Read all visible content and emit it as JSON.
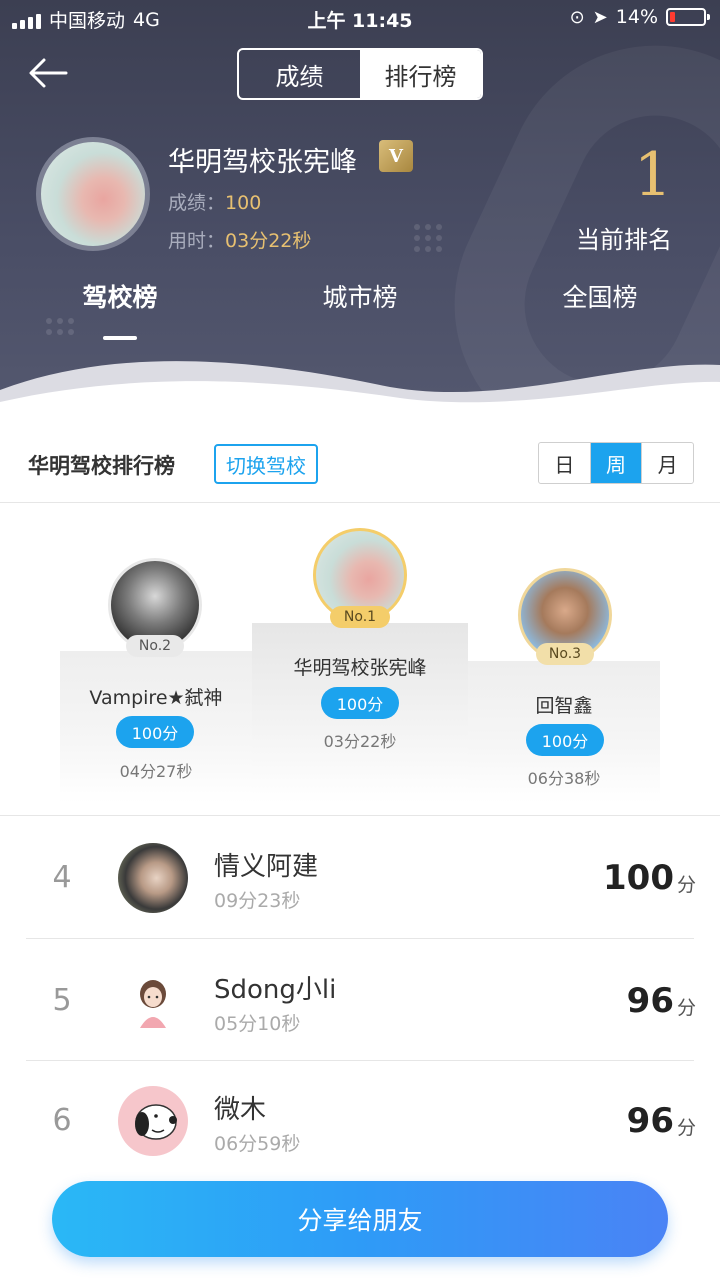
{
  "status_bar": {
    "carrier": "中国移动",
    "network": "4G",
    "time": "上午 11:45",
    "battery": "14%"
  },
  "nav": {
    "segments": [
      "成绩",
      "排行榜"
    ],
    "active_segment": "排行榜"
  },
  "me": {
    "name": "华明驾校张宪峰",
    "vip_badge": "V",
    "score_label": "成绩：",
    "score": "100",
    "time_label": "用时：",
    "time": "03分22秒",
    "rank": "1",
    "rank_label": "当前排名"
  },
  "rank_tabs": [
    "驾校榜",
    "城市榜",
    "全国榜"
  ],
  "active_rank_tab": "驾校榜",
  "board": {
    "title": "华明驾校排行榜",
    "switch_label": "切换驾校",
    "periods": [
      "日",
      "周",
      "月"
    ],
    "active_period": "周"
  },
  "podium": {
    "first": {
      "badge": "No.1",
      "name": "华明驾校张宪峰",
      "score": "100分",
      "time": "03分22秒"
    },
    "second": {
      "badge": "No.2",
      "name": "Vampire★弑神",
      "score": "100分",
      "time": "04分27秒"
    },
    "third": {
      "badge": "No.3",
      "name": "回智鑫",
      "score": "100分",
      "time": "06分38秒"
    }
  },
  "list": [
    {
      "rank": "4",
      "name": "情义阿建",
      "time": "09分23秒",
      "score": "100",
      "unit": "分"
    },
    {
      "rank": "5",
      "name": "Sdong小li",
      "time": "05分10秒",
      "score": "96",
      "unit": "分"
    },
    {
      "rank": "6",
      "name": "微木",
      "time": "06分59秒",
      "score": "96",
      "unit": "分"
    }
  ],
  "share_label": "分享给朋友",
  "colors": {
    "header_bg": "#464a60",
    "accent_blue": "#1ca3ee",
    "gold": "#e7c071",
    "badge_gold": "#f4cd6a"
  }
}
